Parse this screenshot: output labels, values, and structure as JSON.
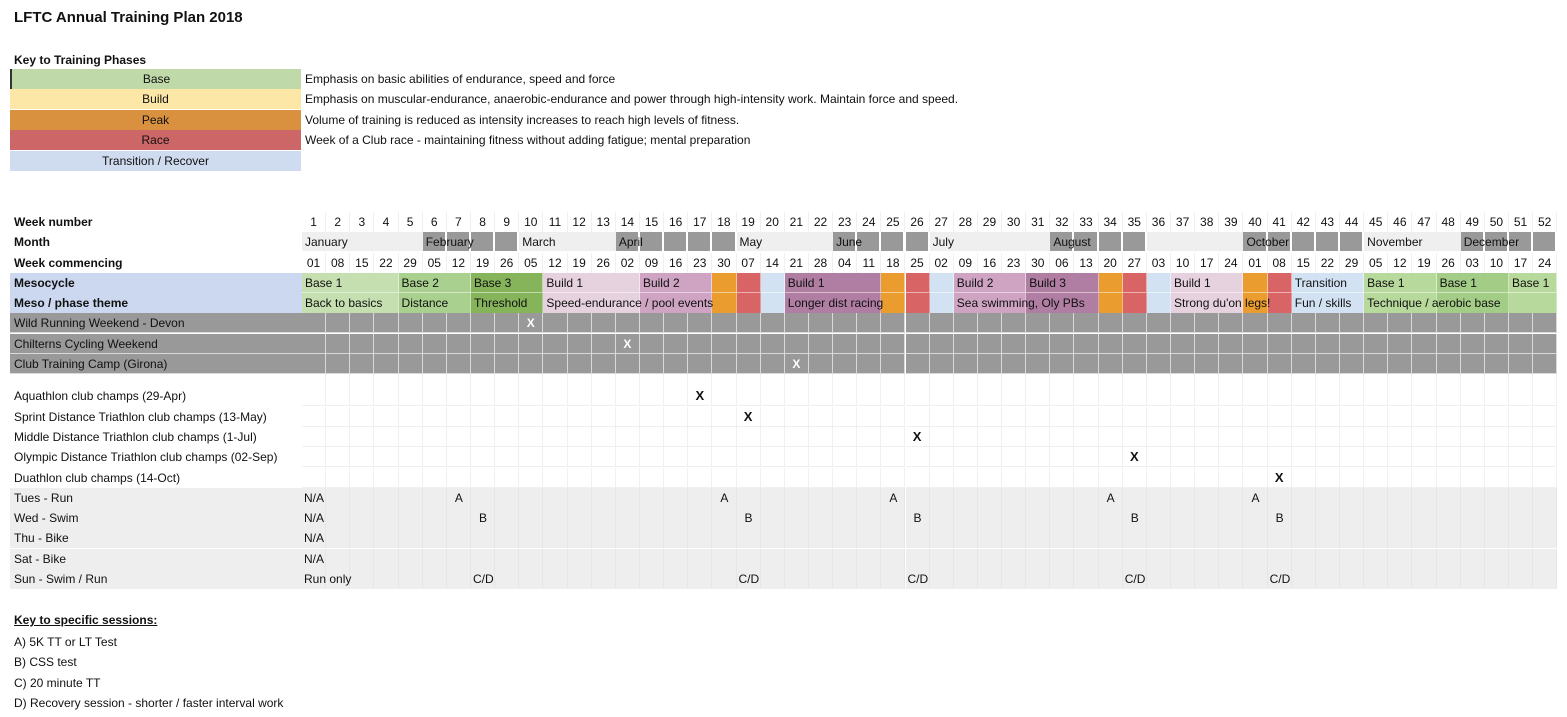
{
  "title": "LFTC Annual Training Plan 2018",
  "phase_key": {
    "title": "Key to Training Phases",
    "items": [
      {
        "name": "Base",
        "color": "#c0d9a8",
        "description": "Emphasis on basic abilities of endurance, speed and force"
      },
      {
        "name": "Build",
        "color": "#fde7a6",
        "description": "Emphasis on muscular-endurance, anaerobic-endurance and power through high-intensity work. Maintain force and speed."
      },
      {
        "name": "Peak",
        "color": "#d99140",
        "description": "Volume of training is reduced as intensity increases to reach high levels of fitness."
      },
      {
        "name": "Race",
        "color": "#cc6667",
        "description": "Week of a Club race - maintaining fitness without adding fatigue; mental preparation"
      },
      {
        "name": "Transition / Recover",
        "color": "#cfdcf0",
        "description": ""
      }
    ]
  },
  "plan": {
    "labels": {
      "week_number": "Week number",
      "month": "Month",
      "week_commencing": "Week commencing",
      "mesocycle": "Mesocycle",
      "theme": "Meso / phase theme"
    },
    "weeks": [
      "1",
      "2",
      "3",
      "4",
      "5",
      "6",
      "7",
      "8",
      "9",
      "10",
      "11",
      "12",
      "13",
      "14",
      "15",
      "16",
      "17",
      "18",
      "19",
      "20",
      "21",
      "22",
      "23",
      "24",
      "25",
      "26",
      "27",
      "28",
      "29",
      "30",
      "31",
      "32",
      "33",
      "34",
      "35",
      "36",
      "37",
      "38",
      "39",
      "40",
      "41",
      "42",
      "43",
      "44",
      "45",
      "46",
      "47",
      "48",
      "49",
      "50",
      "51",
      "52"
    ],
    "week_commencing": [
      "01",
      "08",
      "15",
      "22",
      "29",
      "05",
      "12",
      "19",
      "26",
      "05",
      "12",
      "19",
      "26",
      "02",
      "09",
      "16",
      "23",
      "30",
      "07",
      "14",
      "21",
      "28",
      "04",
      "11",
      "18",
      "25",
      "02",
      "09",
      "16",
      "23",
      "30",
      "06",
      "13",
      "20",
      "27",
      "03",
      "10",
      "17",
      "24",
      "01",
      "08",
      "15",
      "22",
      "29",
      "05",
      "12",
      "19",
      "26",
      "03",
      "10",
      "17",
      "24"
    ],
    "months": [
      {
        "name": "January",
        "start": 1,
        "end": 5,
        "shade": "light"
      },
      {
        "name": "February",
        "start": 6,
        "end": 9,
        "shade": "dark"
      },
      {
        "name": "March",
        "start": 10,
        "end": 13,
        "shade": "light"
      },
      {
        "name": "April",
        "start": 14,
        "end": 18,
        "shade": "dark"
      },
      {
        "name": "May",
        "start": 19,
        "end": 22,
        "shade": "light"
      },
      {
        "name": "June",
        "start": 23,
        "end": 26,
        "shade": "dark"
      },
      {
        "name": "July",
        "start": 27,
        "end": 31,
        "shade": "light"
      },
      {
        "name": "August",
        "start": 32,
        "end": 35,
        "shade": "dark"
      },
      {
        "name": "",
        "start": 36,
        "end": 39,
        "shade": "light"
      },
      {
        "name": "October",
        "start": 40,
        "end": 44,
        "shade": "dark"
      },
      {
        "name": "November",
        "start": 45,
        "end": 48,
        "shade": "light"
      },
      {
        "name": "December",
        "start": 49,
        "end": 52,
        "shade": "dark"
      }
    ],
    "mesocycles": [
      {
        "label": "Base 1",
        "start": 1,
        "end": 4,
        "color": "#c5dfb0"
      },
      {
        "label": "Base 2",
        "start": 5,
        "end": 7,
        "color": "#a9d08e"
      },
      {
        "label": "Base 3",
        "start": 8,
        "end": 10,
        "color": "#86b45a"
      },
      {
        "label": "Build 1",
        "start": 11,
        "end": 14,
        "color": "#e6d1df"
      },
      {
        "label": "Build 2",
        "start": 15,
        "end": 17,
        "color": "#cfa4c3"
      },
      {
        "label": "",
        "start": 18,
        "end": 18,
        "color": "#eb9c2e"
      },
      {
        "label": "",
        "start": 19,
        "end": 19,
        "color": "#d86466"
      },
      {
        "label": "",
        "start": 20,
        "end": 20,
        "color": "#d2e2f3"
      },
      {
        "label": "Build 1",
        "start": 21,
        "end": 24,
        "color": "#b07da3"
      },
      {
        "label": "",
        "start": 25,
        "end": 25,
        "color": "#eb9c2e"
      },
      {
        "label": "",
        "start": 26,
        "end": 26,
        "color": "#d86466"
      },
      {
        "label": "",
        "start": 27,
        "end": 27,
        "color": "#d2e2f3"
      },
      {
        "label": "Build 2",
        "start": 28,
        "end": 30,
        "color": "#cfa4c3"
      },
      {
        "label": "Build 3",
        "start": 31,
        "end": 33,
        "color": "#b07da3"
      },
      {
        "label": "",
        "start": 34,
        "end": 34,
        "color": "#eb9c2e"
      },
      {
        "label": "",
        "start": 35,
        "end": 35,
        "color": "#d86466"
      },
      {
        "label": "",
        "start": 36,
        "end": 36,
        "color": "#d2e2f3"
      },
      {
        "label": "Build 1",
        "start": 37,
        "end": 39,
        "color": "#e6d1df"
      },
      {
        "label": "",
        "start": 40,
        "end": 40,
        "color": "#eb9c2e"
      },
      {
        "label": "",
        "start": 41,
        "end": 41,
        "color": "#d86466"
      },
      {
        "label": "Transition",
        "start": 42,
        "end": 44,
        "color": "#d2e2f3"
      },
      {
        "label": "Base 1",
        "start": 45,
        "end": 47,
        "color": "#b8d99c"
      },
      {
        "label": "Base 1",
        "start": 48,
        "end": 50,
        "color": "#a3cd86"
      },
      {
        "label": "Base 1",
        "start": 51,
        "end": 52,
        "color": "#b8d99c"
      }
    ],
    "themes": [
      {
        "label": "Back to basics",
        "start": 1,
        "end": 4,
        "color": "#c5dfb0"
      },
      {
        "label": "Distance",
        "start": 5,
        "end": 7,
        "color": "#a9d08e"
      },
      {
        "label": "Threshold",
        "start": 8,
        "end": 10,
        "color": "#86b45a"
      },
      {
        "label": "Speed-endurance / pool events",
        "start": 11,
        "end": 14,
        "color": "#e6d1df"
      },
      {
        "label": "",
        "start": 15,
        "end": 17,
        "color": "#cfa4c3"
      },
      {
        "label": "",
        "start": 18,
        "end": 18,
        "color": "#eb9c2e"
      },
      {
        "label": "",
        "start": 19,
        "end": 19,
        "color": "#d86466"
      },
      {
        "label": "",
        "start": 20,
        "end": 20,
        "color": "#d2e2f3"
      },
      {
        "label": "Longer dist racing",
        "start": 21,
        "end": 24,
        "color": "#b07da3"
      },
      {
        "label": "",
        "start": 25,
        "end": 25,
        "color": "#eb9c2e"
      },
      {
        "label": "",
        "start": 26,
        "end": 26,
        "color": "#d86466"
      },
      {
        "label": "",
        "start": 27,
        "end": 27,
        "color": "#d2e2f3"
      },
      {
        "label": "Sea swimming, Oly PBs",
        "start": 28,
        "end": 30,
        "color": "#cfa4c3"
      },
      {
        "label": "",
        "start": 31,
        "end": 33,
        "color": "#b07da3"
      },
      {
        "label": "",
        "start": 34,
        "end": 34,
        "color": "#eb9c2e"
      },
      {
        "label": "",
        "start": 35,
        "end": 35,
        "color": "#d86466"
      },
      {
        "label": "",
        "start": 36,
        "end": 36,
        "color": "#d2e2f3"
      },
      {
        "label": "Strong du'on legs!",
        "start": 37,
        "end": 39,
        "color": "#e6d1df"
      },
      {
        "label": "",
        "start": 40,
        "end": 40,
        "color": "#eb9c2e"
      },
      {
        "label": "",
        "start": 41,
        "end": 41,
        "color": "#d86466"
      },
      {
        "label": "Fun / skills",
        "start": 42,
        "end": 44,
        "color": "#d2e2f3"
      },
      {
        "label": "Technique / aerobic base",
        "start": 45,
        "end": 47,
        "color": "#b8d99c"
      },
      {
        "label": "",
        "start": 48,
        "end": 50,
        "color": "#a3cd86"
      },
      {
        "label": "",
        "start": 51,
        "end": 52,
        "color": "#b8d99c"
      }
    ],
    "camps": [
      {
        "label": "Wild Running Weekend - Devon",
        "weeks": [
          10
        ],
        "mark": "X"
      },
      {
        "label": "Chilterns Cycling Weekend",
        "weeks": [
          14
        ],
        "mark": "X"
      },
      {
        "label": "Club Training Camp (Girona)",
        "weeks": [
          21
        ],
        "mark": "X"
      }
    ],
    "races": [
      {
        "label": "Aquathlon club champs (29-Apr)",
        "weeks": [
          17
        ],
        "mark": "X"
      },
      {
        "label": "Sprint Distance Triathlon club champs (13-May)",
        "weeks": [
          19
        ],
        "mark": "X"
      },
      {
        "label": "Middle Distance Triathlon club champs (1-Jul)",
        "weeks": [
          26
        ],
        "mark": "X"
      },
      {
        "label": "Olympic Distance Triathlon club champs (02-Sep)",
        "weeks": [
          35
        ],
        "mark": "X"
      },
      {
        "label": "Duathlon club champs (14-Oct)",
        "weeks": [
          41
        ],
        "mark": "X"
      }
    ],
    "sessions": [
      {
        "label": "Tues - Run",
        "entries": [
          {
            "week": 1,
            "text": "N/A"
          },
          {
            "week": 7,
            "text": "A"
          },
          {
            "week": 18,
            "text": "A"
          },
          {
            "week": 25,
            "text": "A"
          },
          {
            "week": 34,
            "text": "A"
          },
          {
            "week": 40,
            "text": "A"
          }
        ]
      },
      {
        "label": "Wed - Swim",
        "entries": [
          {
            "week": 1,
            "text": "N/A"
          },
          {
            "week": 8,
            "text": "B"
          },
          {
            "week": 19,
            "text": "B"
          },
          {
            "week": 26,
            "text": "B"
          },
          {
            "week": 35,
            "text": "B"
          },
          {
            "week": 41,
            "text": "B"
          }
        ]
      },
      {
        "label": "Thu - Bike",
        "entries": [
          {
            "week": 1,
            "text": "N/A"
          }
        ]
      },
      {
        "label": "Sat - Bike",
        "entries": [
          {
            "week": 1,
            "text": "N/A"
          }
        ]
      },
      {
        "label": "Sun - Swim / Run",
        "entries": [
          {
            "week": 1,
            "text": "Run only"
          },
          {
            "week": 8,
            "text": "C/D"
          },
          {
            "week": 19,
            "text": "C/D"
          },
          {
            "week": 26,
            "text": "C/D"
          },
          {
            "week": 35,
            "text": "C/D"
          },
          {
            "week": 41,
            "text": "C/D"
          }
        ]
      }
    ]
  },
  "colors": {
    "header_label_bg": "#cbd8f0",
    "month_light": "#efefef",
    "month_dark": "#999999",
    "camp_gray": "#999999",
    "session_bg": "#eeeeee"
  },
  "session_key": {
    "title": "Key to specific sessions:",
    "items": [
      "A) 5K TT or LT Test",
      "B) CSS test",
      "C) 20 minute TT",
      "D) Recovery session - shorter / faster interval work"
    ]
  }
}
